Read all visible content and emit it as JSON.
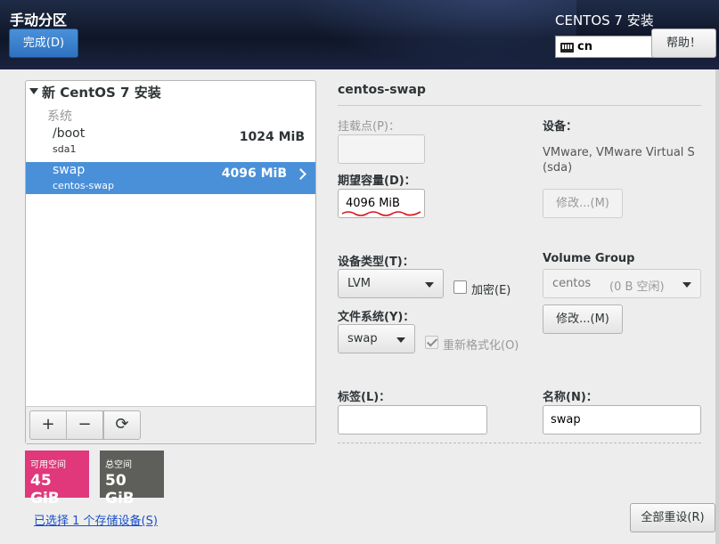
{
  "header": {
    "page_title": "手动分区",
    "done_label": "完成(D)",
    "install_title": "CENTOS 7 安装",
    "keyboard_layout": "cn",
    "help_label": "帮助！"
  },
  "left_panel": {
    "root_label": "新 CentOS 7 安装",
    "category": "系统",
    "mount_points": [
      {
        "name": "/boot",
        "device": "sda1",
        "size": "1024 MiB",
        "selected": false
      },
      {
        "name": "swap",
        "device": "centos-swap",
        "size": "4096 MiB",
        "selected": true
      }
    ],
    "toolbar": {
      "add": "+",
      "remove": "−",
      "refresh": "⟳"
    }
  },
  "space": {
    "available_label": "可用空间",
    "available_value": "45 GiB",
    "total_label": "总空间",
    "total_value": "50 GiB",
    "available_color": "#e0387a",
    "total_color": "#5e5e5a"
  },
  "storage_link": "已选择 1 个存储设备(S)",
  "detail": {
    "title": "centos-swap",
    "mount_point_label": "挂载点(P)：",
    "mount_point_value": "",
    "capacity_label": "期望容量(D)：",
    "capacity_value": "4096 MiB",
    "device_label": "设备：",
    "device_info": "VMware, VMware Virtual S (sda)",
    "modify_device_label": "修改...(M)",
    "device_type_label": "设备类型(T)：",
    "device_type_value": "LVM",
    "encrypt_label": "加密(E)",
    "encrypt_checked": false,
    "volume_group_label": "Volume Group",
    "volume_group_value": "centos",
    "volume_group_free": "(0 B 空闲)",
    "modify_vg_label": "修改...(M)",
    "filesystem_label": "文件系统(Y)：",
    "filesystem_value": "swap",
    "reformat_label": "重新格式化(O)",
    "reformat_checked": true,
    "tag_label": "标签(L)：",
    "tag_value": "",
    "name_label": "名称(N)：",
    "name_value": "swap",
    "reset_all_label": "全部重设(R)"
  }
}
